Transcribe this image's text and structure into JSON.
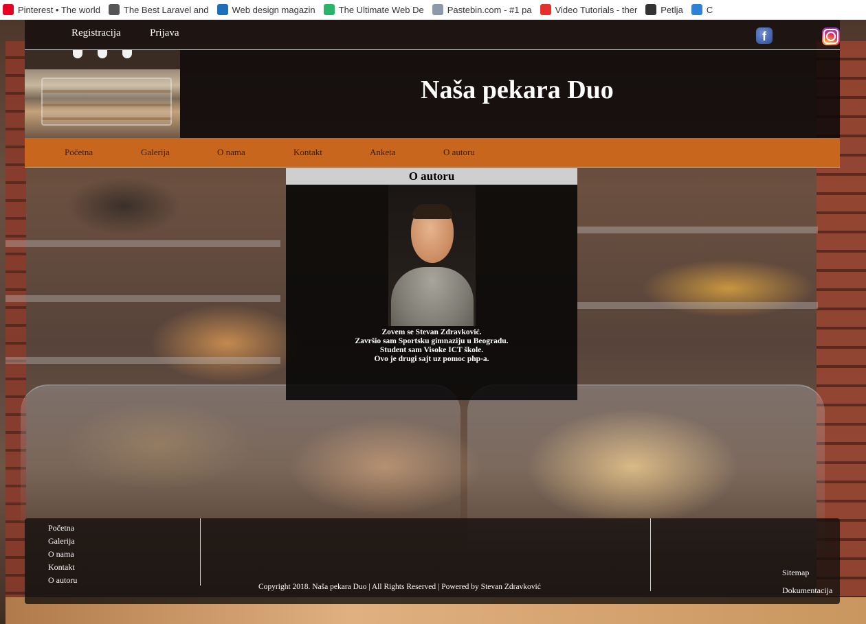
{
  "browser": {
    "bookmarks": [
      {
        "label": "Pinterest • The world",
        "icon": "pinterest-icon",
        "color": "#e60023"
      },
      {
        "label": "The Best Laravel and",
        "icon": "laravel-icon",
        "color": "#555555"
      },
      {
        "label": "Web design magazin",
        "icon": "webdesign-icon",
        "color": "#1c6fb8"
      },
      {
        "label": "The Ultimate Web De",
        "icon": "ultimate-icon",
        "color": "#2ab36a"
      },
      {
        "label": "Pastebin.com - #1 pa",
        "icon": "pastebin-icon",
        "color": "#8a9aa8"
      },
      {
        "label": "Video Tutorials - ther",
        "icon": "video-icon",
        "color": "#e4312b"
      },
      {
        "label": "Petlja",
        "icon": "infinity-icon",
        "color": "#333333"
      },
      {
        "label": "C",
        "icon": "c-icon",
        "color": "#2e82d6"
      }
    ]
  },
  "topbar": {
    "register": "Registracija",
    "login": "Prijava",
    "facebook_icon": "facebook-icon",
    "instagram_icon": "instagram-icon"
  },
  "banner": {
    "title": "Naša pekara Duo"
  },
  "nav": {
    "items": [
      "Početna",
      "Galerija",
      "O nama",
      "Kontakt",
      "Anketa",
      "O autoru"
    ]
  },
  "content": {
    "title": "O autoru",
    "bio": [
      "Zovem se Stevan Zdravković.",
      "Završio sam Sportsku gimnaziju u Beogradu.",
      "Student sam Visoke ICT škole.",
      "Ovo je drugi sajt uz pomoc php-a."
    ]
  },
  "footer": {
    "links": [
      "Početna",
      "Galerija",
      "O nama",
      "Kontakt",
      "O autoru"
    ],
    "copyright": "Copyright 2018. Naša pekara Duo | All Rights Reserved | Powered by Stevan Zdravković",
    "sitemap": "Sitemap",
    "docs": "Dokumentacija"
  },
  "colors": {
    "nav_orange": "#c8661e",
    "title_bar_gray": "#cfcfcf"
  }
}
